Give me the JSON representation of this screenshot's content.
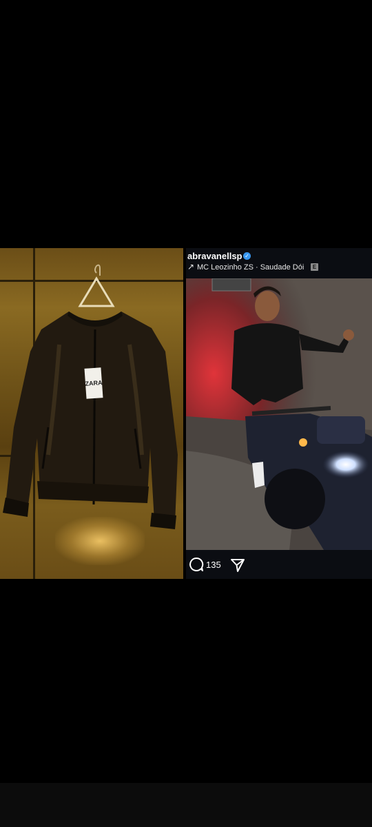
{
  "post": {
    "username": "abravanellsp",
    "verified_icon": "verified-badge-icon",
    "music_arrow_icon": "north-east-arrow-icon",
    "music": "MC Leozinho ZS · Saudade Dói",
    "explicit_label": "E",
    "comment_count": "135",
    "comment_icon": "comment-bubble-icon",
    "share_icon": "send-paper-plane-icon"
  },
  "product": {
    "tag_brand": "ZARA"
  },
  "colors": {
    "background": "#000000",
    "verified": "#3897f0",
    "post_background": "#0b0d12",
    "gold_wall": "#7a5c1c"
  }
}
